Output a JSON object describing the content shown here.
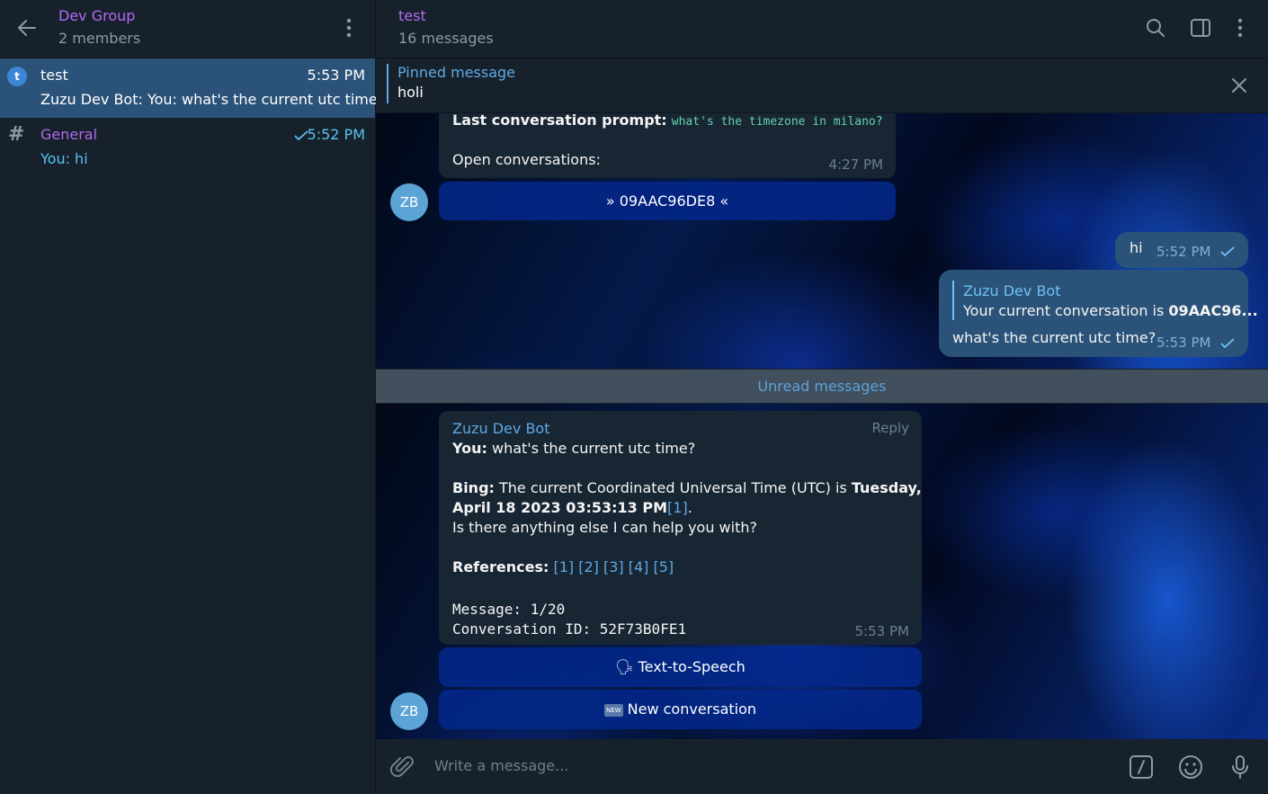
{
  "sidebar": {
    "header": {
      "title": "Dev Group",
      "subtitle": "2 members"
    },
    "dialogs": [
      {
        "avatar_letter": "t",
        "name": "test",
        "time": "5:53 PM",
        "preview": "Zuzu Dev Bot: You: what's the current utc time?"
      },
      {
        "name": "General",
        "time": "5:52 PM",
        "preview": "You: hi"
      }
    ]
  },
  "chat": {
    "header": {
      "title": "test",
      "subtitle": "16 messages"
    },
    "pinned": {
      "label": "Pinned message",
      "text": "holi"
    },
    "bot_avatar": "ZB",
    "msg1": {
      "prompt_label": "Last conversation prompt:",
      "prompt_value": "what's the timezone in milano?",
      "open_label": "Open conversations:",
      "time": "4:27 PM",
      "button": "» 09AAC96DE8 «"
    },
    "out1": {
      "text": "hi",
      "time": "5:52 PM"
    },
    "out2": {
      "reply_author": "Zuzu Dev Bot",
      "reply_prefix": "Your current conversation is ",
      "reply_bold": "09AAC96...",
      "text": "what's the current utc time?",
      "time": "5:53 PM"
    },
    "unread_label": "Unread messages",
    "msg2": {
      "author": "Zuzu Dev Bot",
      "reply_label": "Reply",
      "you_label": "You:",
      "you_text": " what's the current utc time?",
      "bing_label": "Bing:",
      "bing_text1": " The current Coordinated Universal Time (UTC) is ",
      "bing_bold1": "Tuesday,",
      "bing_bold2": "April 18 2023 03:53:13 PM",
      "bing_ref": "[1]",
      "bing_end": ".",
      "followup": "Is there anything else I can help you with?",
      "refs_label": "References:",
      "refs": "[1] [2] [3] [4] [5]",
      "meta1": "Message: 1/20",
      "meta2": "Conversation ID: 52F73B0FE1",
      "time": "5:53 PM",
      "button_tts": "Text-to-Speech",
      "button_tts_icon": "🗣",
      "button_new": "New conversation",
      "button_new_icon": "NEW"
    },
    "composer": {
      "placeholder": "Write a message..."
    }
  },
  "colors": {
    "accent": "#5ea9e5",
    "group_name": "#b36af2",
    "sidebar_bg": "#17212b",
    "bubble_in": "#182533",
    "bubble_out": "#2b5278"
  },
  "icons": [
    "back-arrow-icon",
    "more-vertical-icon",
    "search-icon",
    "side-panel-icon",
    "close-icon",
    "paperclip-icon",
    "bot-command-icon",
    "emoji-icon",
    "microphone-icon",
    "check-icon"
  ]
}
